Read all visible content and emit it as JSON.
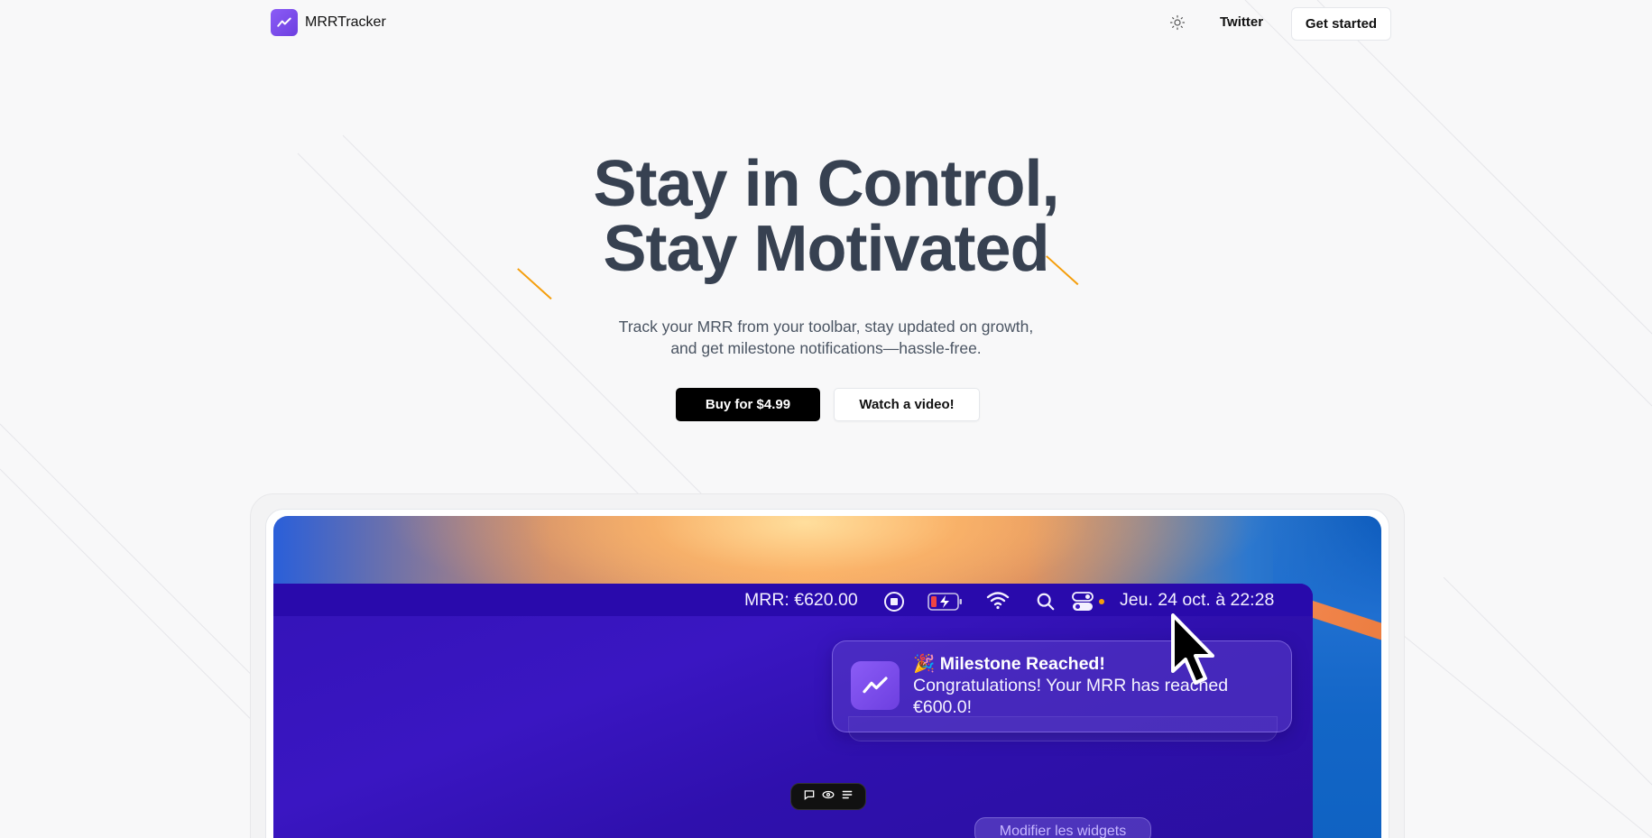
{
  "nav": {
    "brand": "MRRTracker",
    "twitter_label": "Twitter",
    "cta_label": "Get started"
  },
  "hero": {
    "title_line1": "Stay in Control,",
    "title_line2": "Stay Motivated",
    "subtitle_line1": "Track your MRR from your toolbar, stay updated on growth,",
    "subtitle_line2": "and get milestone notifications—hassle-free.",
    "buy_label": "Buy for $4.99",
    "video_label": "Watch a video!"
  },
  "showcase": {
    "menubar": {
      "mrr": "MRR: €620.00",
      "date": "Jeu. 24 oct. à  22:28"
    },
    "notification": {
      "title": "🎉 Milestone Reached!",
      "body": "Congratulations! Your MRR has reached €600.0!"
    },
    "widgets_label": "Modifier les widgets"
  },
  "colors": {
    "brand": "#7c4dea",
    "accent_line": "#f59e0b",
    "headline": "#374151",
    "primary_button": "#000000",
    "desktop": "#3413b8"
  },
  "icons": [
    "chart-line-icon",
    "sun-icon",
    "record-icon",
    "battery-icon",
    "wifi-icon",
    "search-icon",
    "control-center-icon",
    "cursor-icon",
    "chat-icon",
    "eye-icon",
    "list-icon"
  ]
}
